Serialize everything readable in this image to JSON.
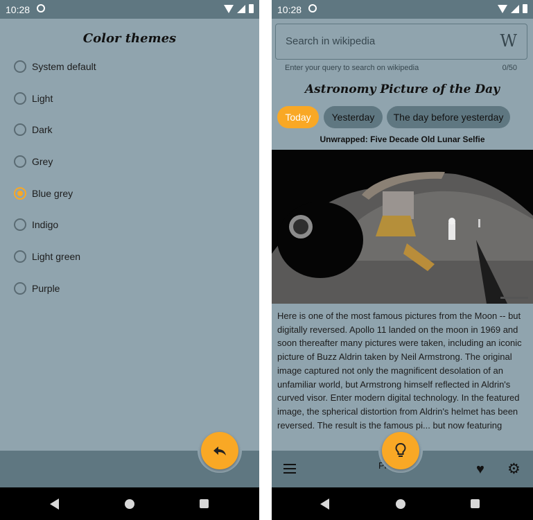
{
  "status_bar": {
    "time": "10:28"
  },
  "left_screen": {
    "title": "Color themes",
    "options": [
      {
        "label": "System default",
        "checked": false
      },
      {
        "label": "Light",
        "checked": false
      },
      {
        "label": "Dark",
        "checked": false
      },
      {
        "label": "Grey",
        "checked": false
      },
      {
        "label": "Blue grey",
        "checked": true
      },
      {
        "label": "Indigo",
        "checked": false
      },
      {
        "label": "Light green",
        "checked": false
      },
      {
        "label": "Purple",
        "checked": false
      }
    ],
    "fab_icon": "reply-icon"
  },
  "right_screen": {
    "search": {
      "placeholder": "Search in wikipedia",
      "helper": "Enter your query to search on wikipedia",
      "counter": "0/50",
      "icon": "W"
    },
    "apod_title": "Astronomy Picture of the Day",
    "chips": [
      "Today",
      "Yesterday",
      "The day before yesterday"
    ],
    "active_chip": "Today",
    "picture_title": "Unwrapped: Five Decade Old Lunar Selfie",
    "explanation": "Here is one of the most famous pictures from the Moon -- but digitally reversed. Apollo 11 landed on the moon in 1969 and soon thereafter many pictures were taken, including an iconic picture of Buzz Aldrin taken by Neil Armstrong. The original image captured not only the magnificent desolation of an unfamiliar world, but Armstrong himself reflected in Aldrin's curved visor.  Enter modern digital technology. In the featured image, the spherical distortion from Aldrin's helmet has been reversed. The result is the famous pi... but now featuring",
    "bottom_bar_label": "Picture",
    "fab_icon": "lightbulb-icon"
  },
  "colors": {
    "background": "#90a4ae",
    "bar": "#5f7781",
    "accent": "#f9a825"
  }
}
